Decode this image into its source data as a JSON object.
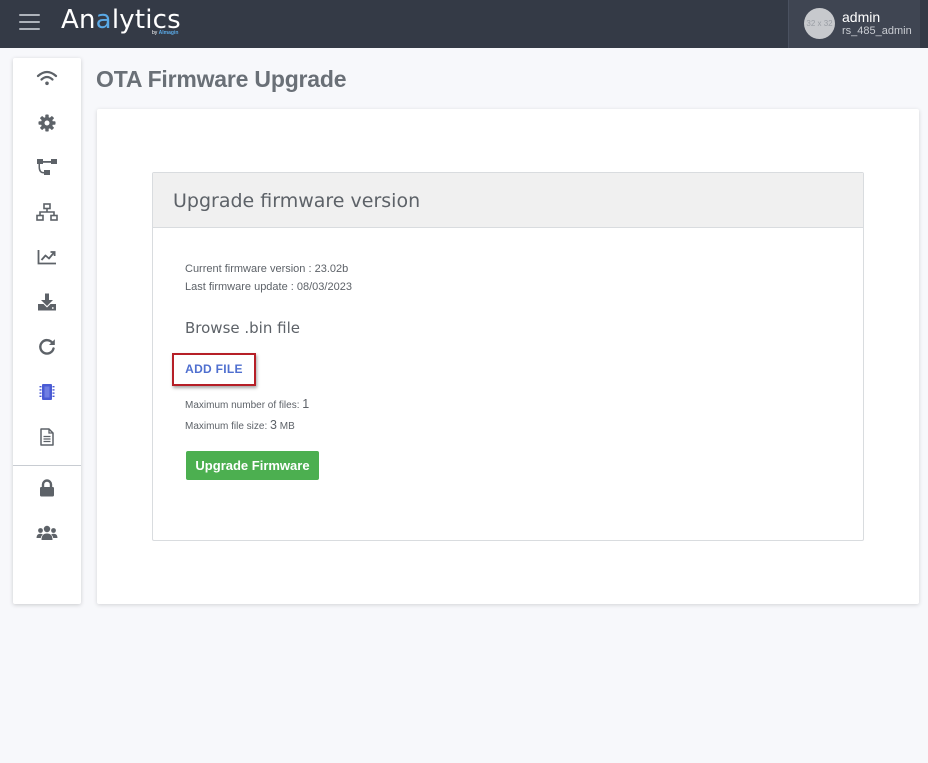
{
  "header": {
    "logo_prefix": "An",
    "logo_accent": "a",
    "logo_suffix": "lytics",
    "logo_by": "by",
    "logo_brand": "Almagin",
    "avatar_placeholder": "32 x 32",
    "user_name": "admin",
    "user_role": "rs_485_admin"
  },
  "sidebar": {
    "items": [
      {
        "icon": "wifi-icon"
      },
      {
        "icon": "gear-icon"
      },
      {
        "icon": "workflow-icon"
      },
      {
        "icon": "network-icon"
      },
      {
        "icon": "chart-line-icon"
      },
      {
        "icon": "download-icon"
      },
      {
        "icon": "refresh-icon"
      },
      {
        "icon": "chip-icon",
        "active": true
      },
      {
        "icon": "document-icon"
      },
      {
        "icon": "lock-icon"
      },
      {
        "icon": "users-icon"
      }
    ]
  },
  "page": {
    "title": "OTA Firmware Upgrade"
  },
  "panel": {
    "heading": "Upgrade firmware version",
    "current_version": "Current firmware version : 23.02b",
    "last_update": "Last firmware update : 08/03/2023",
    "browse_label": "Browse .bin file",
    "add_file_label": "ADD FILE",
    "max_files_label": "Maximum number of files:",
    "max_files_value": "1",
    "max_size_label": "Maximum file size:",
    "max_size_value": "3",
    "max_size_unit": "MB",
    "upgrade_label": "Upgrade Firmware"
  },
  "colors": {
    "topbar": "#343a46",
    "accent": "#5aa9e6",
    "add_file_border": "#b61f27",
    "add_file_text": "#4f6fcf",
    "upgrade_button": "#4caf50",
    "active_icon": "#4a5bd4"
  }
}
